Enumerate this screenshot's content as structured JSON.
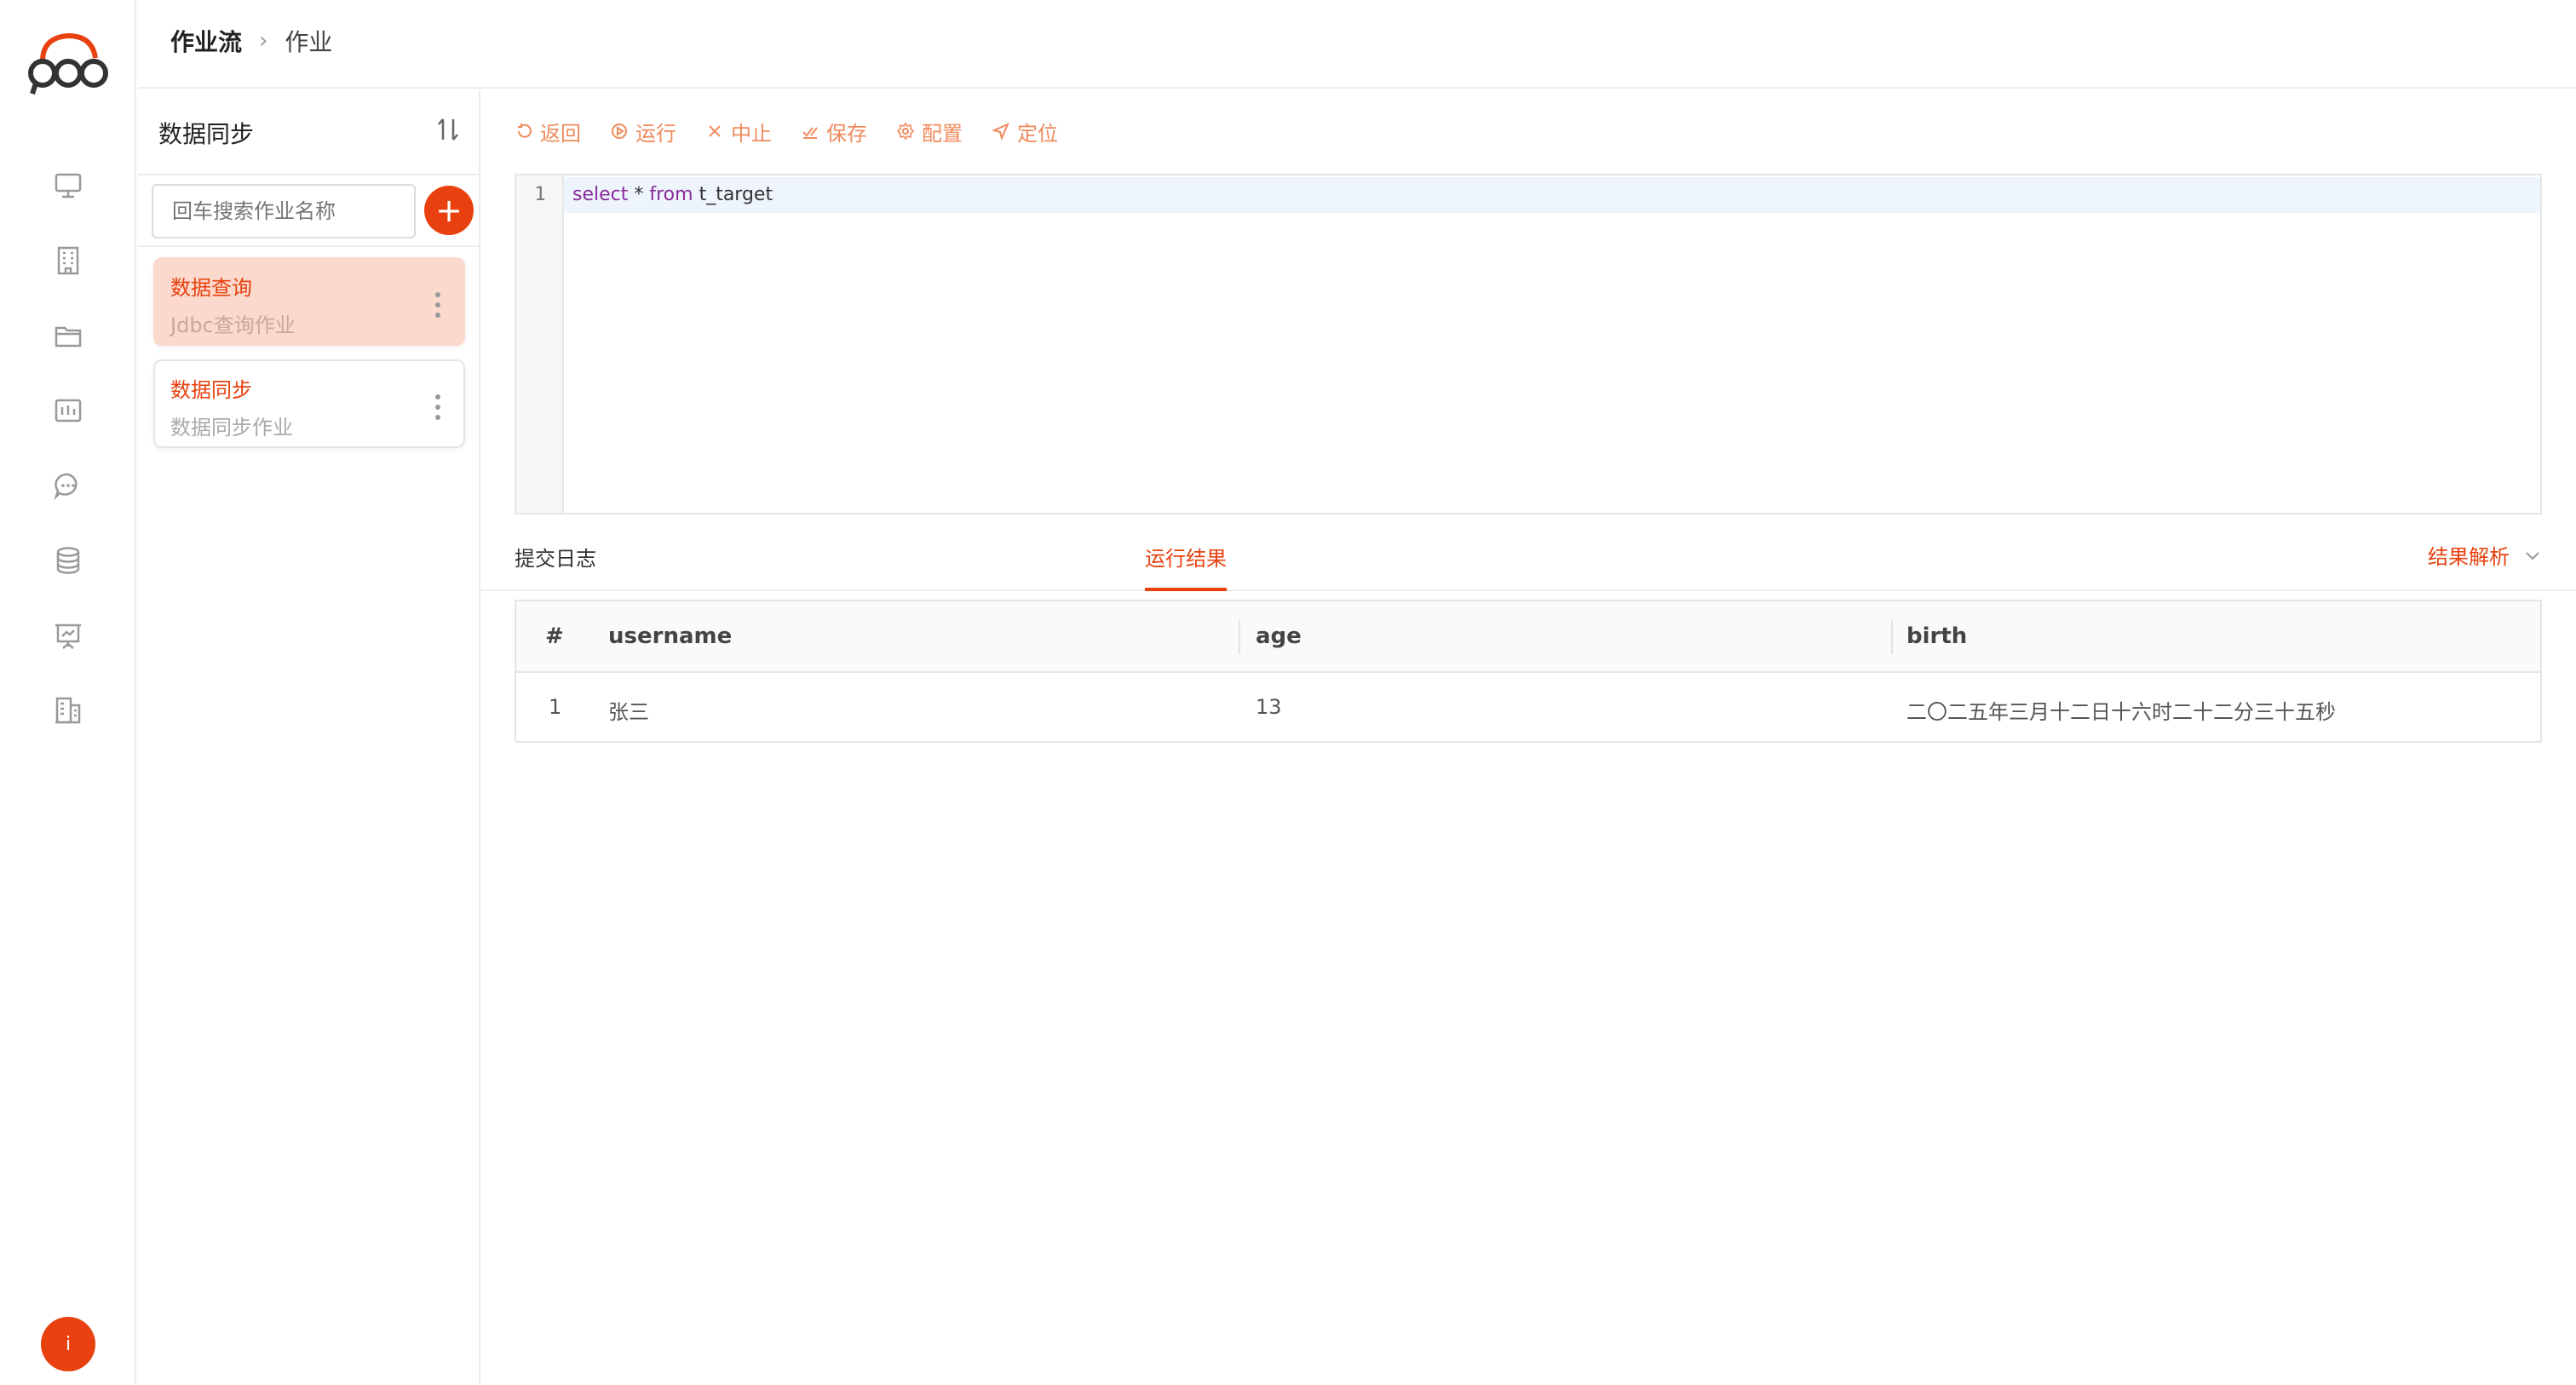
{
  "breadcrumb": {
    "parent": "作业流",
    "separator": "›",
    "current": "作业"
  },
  "sidebar": {
    "icons": [
      "monitor-icon",
      "building-icon",
      "folder-icon",
      "dashboard-icon",
      "chat-icon",
      "database-icon",
      "presentation-icon",
      "office-icon"
    ],
    "avatar_label": "i"
  },
  "job_panel": {
    "title": "数据同步",
    "search": {
      "placeholder": "回车搜索作业名称",
      "value": ""
    },
    "add_label": "+",
    "jobs": [
      {
        "name": "数据查询",
        "desc": "Jdbc查询作业",
        "active": true
      },
      {
        "name": "数据同步",
        "desc": "数据同步作业",
        "active": false
      }
    ]
  },
  "toolbar": {
    "back": "返回",
    "run": "运行",
    "stop": "中止",
    "save": "保存",
    "config": "配置",
    "locate": "定位"
  },
  "editor": {
    "line_number": "1",
    "code_kw1": "select",
    "code_mid": " * ",
    "code_kw2": "from",
    "code_rest": " t_target"
  },
  "tabs": {
    "log": "提交日志",
    "result": "运行结果",
    "analyze": "结果解析"
  },
  "result_table": {
    "columns": [
      "#",
      "username",
      "age",
      "birth"
    ],
    "rows": [
      [
        "1",
        "张三",
        "13",
        "二〇二五年三月十二日十六时二十二分三十五秒"
      ]
    ]
  },
  "colors": {
    "accent": "#e8410f",
    "accent_light": "#f08a5d",
    "active_card": "#fbd9cc"
  }
}
